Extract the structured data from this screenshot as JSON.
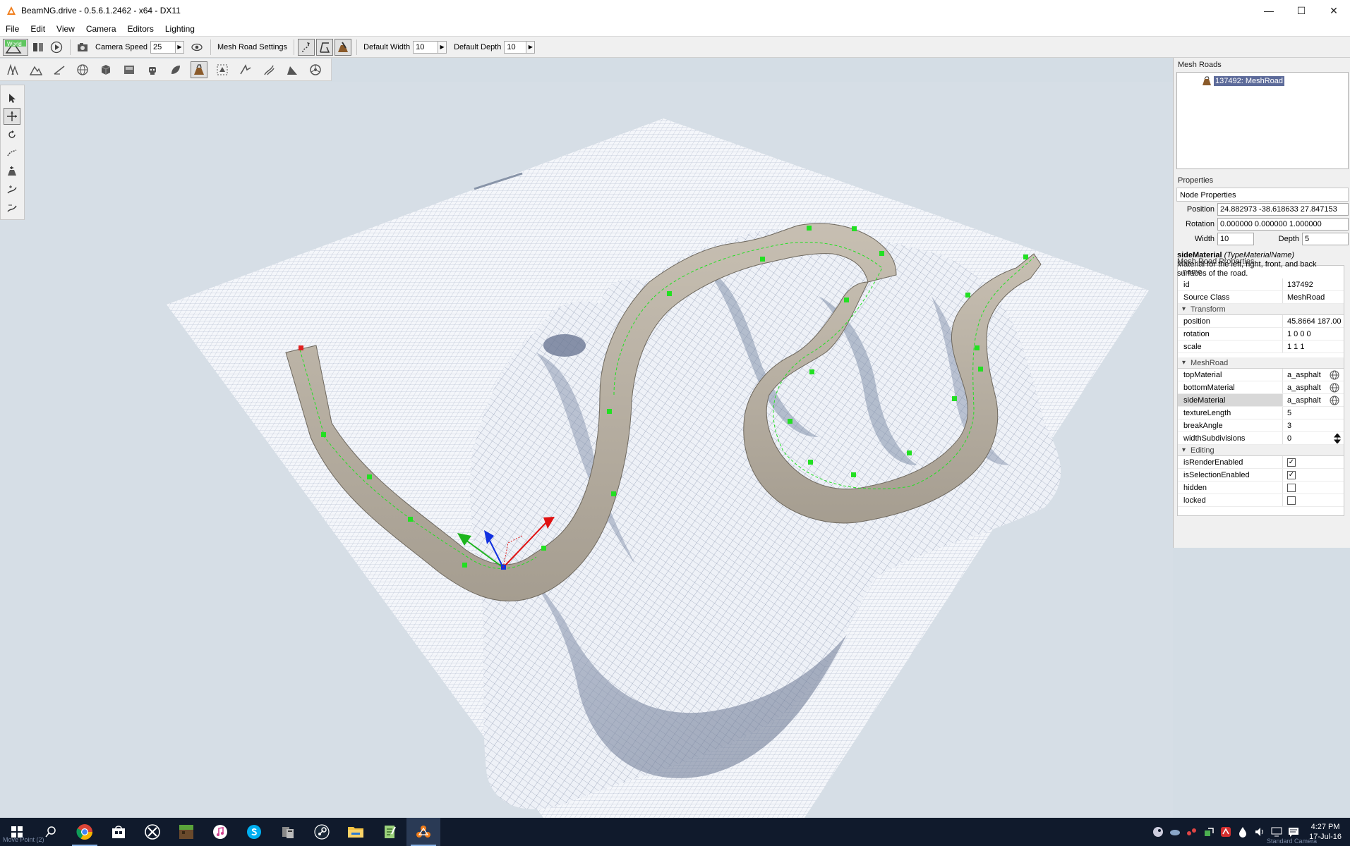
{
  "window": {
    "title": "BeamNG.drive - 0.5.6.1.2462 - x64 - DX11",
    "minimize": "—",
    "maximize": "☐",
    "close": "✕"
  },
  "menu": [
    "File",
    "Edit",
    "View",
    "Camera",
    "Editors",
    "Lighting"
  ],
  "toolbar": {
    "mode_badge": "World",
    "camera_speed_label": "Camera Speed",
    "camera_speed_value": "25",
    "mesh_road_settings_label": "Mesh Road Settings",
    "default_width_label": "Default Width",
    "default_width_value": "10",
    "default_depth_label": "Default Depth",
    "default_depth_value": "10",
    "spin_arrow": "▶"
  },
  "mesh_roads": {
    "header": "Mesh Roads",
    "selected_item": "137492: MeshRoad"
  },
  "properties": {
    "header": "Properties",
    "node_header": "Node Properties",
    "position_label": "Position",
    "position_value": "24.882973 -38.618633 27.847153",
    "rotation_label": "Rotation",
    "rotation_value": "0.000000 0.000000 1.000000",
    "width_label": "Width",
    "width_value": "10",
    "depth_label": "Depth",
    "depth_value": "5"
  },
  "tooltip": {
    "title": "sideMaterial",
    "type": "(TypeMaterialName)",
    "overlay": "Mesh Road Properties",
    "line1": "Material for the left, right, front, and back",
    "line2": "surfaces of the road.",
    "name_overlap": "name"
  },
  "inspector": {
    "id_key": "id",
    "id_val": "137492",
    "source_key": "Source Class",
    "source_val": "MeshRoad",
    "group_transform": "Transform",
    "position_key": "position",
    "position_val": "45.8664 187.00",
    "rotation_key": "rotation",
    "rotation_val": "1 0 0 0",
    "scale_key": "scale",
    "scale_val": "1 1 1",
    "group_meshroad": "MeshRoad",
    "top_key": "topMaterial",
    "top_val": "a_asphalt",
    "bottom_key": "bottomMaterial",
    "bottom_val": "a_asphalt",
    "side_key": "sideMaterial",
    "side_val": "a_asphalt",
    "texlen_key": "textureLength",
    "texlen_val": "5",
    "break_key": "breakAngle",
    "break_val": "3",
    "widthsub_key": "widthSubdivisions",
    "widthsub_val": "0",
    "group_editing": "Editing",
    "render_key": "isRenderEnabled",
    "render_val": true,
    "selection_key": "isSelectionEnabled",
    "selection_val": true,
    "hidden_key": "hidden",
    "hidden_val": false,
    "locked_key": "locked",
    "locked_val": false,
    "check_mark": "✓"
  },
  "status": {
    "left": "Move Point (2)",
    "right": "Standard Camera"
  },
  "clock": {
    "time": "4:27 PM",
    "date": "17-Jul-16"
  },
  "colors": {
    "selection": "#5d6b9a",
    "taskbar": "#101a2c",
    "node_green": "#22e022",
    "node_red": "#e02020"
  }
}
